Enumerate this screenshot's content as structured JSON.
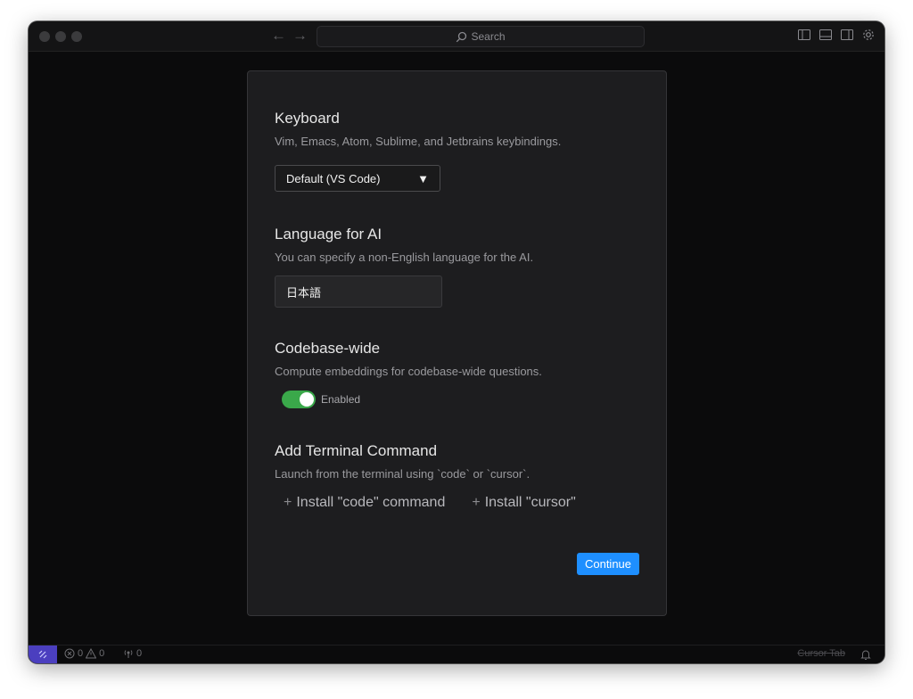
{
  "colors": {
    "accent": "#1e8fff",
    "toggle_on": "#3aa84a",
    "remote_bg": "#4b3fbf"
  },
  "titlebar": {
    "search_label": "Search",
    "icons": [
      "toggle-primary-sidebar-icon",
      "toggle-panel-icon",
      "toggle-secondary-sidebar-icon",
      "gear-icon"
    ]
  },
  "onboarding": {
    "keyboard": {
      "title": "Keyboard",
      "description": "Vim, Emacs, Atom, Sublime, and Jetbrains keybindings.",
      "selected": "Default (VS Code)"
    },
    "language": {
      "title": "Language for AI",
      "description": "You can specify a non-English language for the AI.",
      "value": "日本語"
    },
    "codebase": {
      "title": "Codebase-wide",
      "description": "Compute embeddings for codebase-wide questions.",
      "toggle_label": "Enabled",
      "enabled": true
    },
    "terminal": {
      "title": "Add Terminal Command",
      "description": "Launch from the terminal using `code` or `cursor`.",
      "install_code": "Install \"code\" command",
      "install_cursor": "Install \"cursor\""
    },
    "continue_label": "Continue"
  },
  "statusbar": {
    "errors": "0",
    "warnings": "0",
    "ports": "0",
    "cursor_tab": "Cursor Tab"
  }
}
